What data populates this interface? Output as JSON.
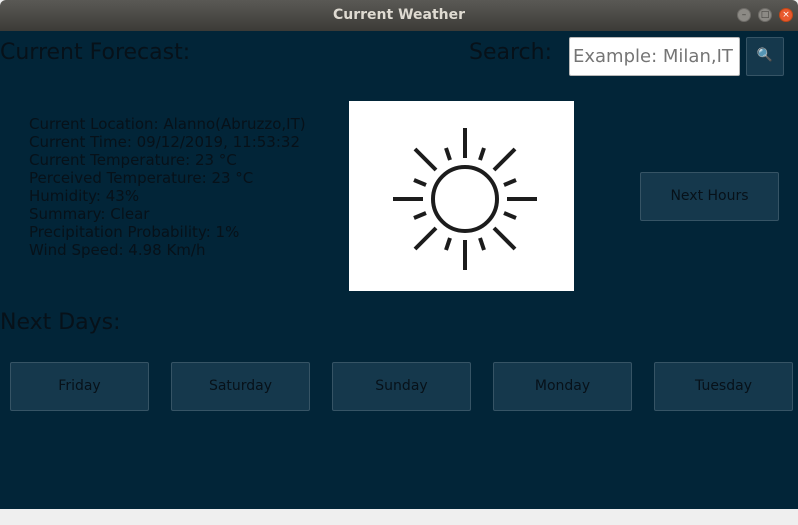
{
  "window": {
    "title": "Current Weather"
  },
  "forecast": {
    "heading": "Current Forecast:"
  },
  "search": {
    "label": "Search:",
    "placeholder": "Example: Milan,IT",
    "button_icon": "search-icon"
  },
  "info": {
    "location": "Current Location: Alanno(Abruzzo,IT)",
    "time": "Current Time: 09/12/2019, 11:53:32",
    "temperature": "Current Temperature: 23 °C",
    "perceived": "Perceived Temperature: 23 °C",
    "humidity": "Humidity: 43%",
    "summary": "Summary: Clear",
    "precipitation": "Precipitation Probability: 1%",
    "wind": "Wind Speed: 4.98 Km/h"
  },
  "weather_icon": "sun-icon",
  "next_hours": {
    "label": "Next Hours"
  },
  "next_days": {
    "heading": "Next Days:",
    "days": [
      "Friday",
      "Saturday",
      "Sunday",
      "Monday",
      "Tuesday"
    ]
  }
}
